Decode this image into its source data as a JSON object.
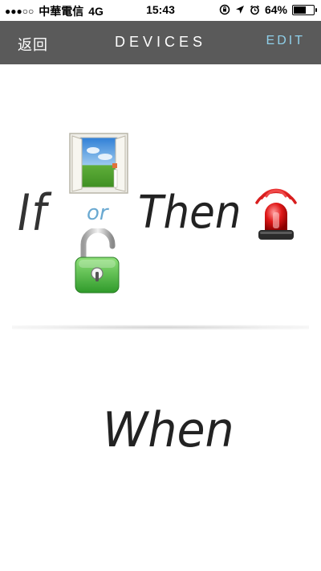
{
  "status_bar": {
    "signal_dots": "●●●○○",
    "carrier": "中華電信",
    "network": "4G",
    "time": "15:43",
    "battery_percent": "64%",
    "battery_level": 0.64
  },
  "nav": {
    "back_label": "返回",
    "title": "DEVICES",
    "edit_label": "EDIT"
  },
  "rule": {
    "if_word": "If",
    "or_word": "or",
    "then_word": "Then",
    "when_word": "When",
    "if_devices": [
      "window-sensor-icon",
      "padlock-icon"
    ],
    "then_devices": [
      "siren-alarm-icon"
    ]
  },
  "colors": {
    "nav_bg": "#5a5a5a",
    "edit_accent": "#8fd0ea",
    "or_accent": "#6aa9d1"
  }
}
